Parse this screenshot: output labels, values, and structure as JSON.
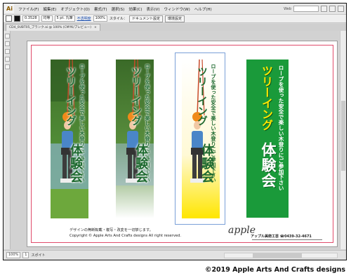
{
  "app": {
    "logo": "Ai",
    "menu": [
      "ファイル(F)",
      "編集(E)",
      "オブジェクト(O)",
      "書式(T)",
      "選択(S)",
      "効果(C)",
      "表示(V)",
      "ウィンドウ(W)",
      "ヘルプ(H)"
    ],
    "workspace": "Web"
  },
  "control_bar": {
    "stroke_value": "0.3528",
    "stroke_style": "均等",
    "brush": "5 pt. 丸筆",
    "opacity_link": "不透明度",
    "opacity_value": "100%",
    "style_label": "スタイル：",
    "document_setup": "ドキュメント設定",
    "preferences": "環境設定"
  },
  "tab": {
    "title": "CD4_0UBT05_ブランク.ai @ 100% (CMYK/プレビュー)",
    "close": "×"
  },
  "banners": {
    "subtitle": "ロープを使った安全で楽しい木登りにご参加下さい",
    "title1": "ツリーイング",
    "title2": "体験会"
  },
  "footer": {
    "line1": "デザインの無断転載・複写・改変を一切禁じます。",
    "line2": "Copyright © Apple Arts And Crafts designs All right reserved."
  },
  "logo": {
    "wordmark": "apple",
    "contact": "アップル美術工芸 ☎0439-32-4671"
  },
  "status": {
    "zoom": "100%",
    "page": "1",
    "tool": "スポイト"
  },
  "watermark": "©2019 Apple Arts And Crafts designs",
  "colors": {
    "banner_green": "#1a9a3a",
    "title_yellow": "#ffe600",
    "text_green": "#1e6a30",
    "bleed_line": "#e04b6a"
  }
}
